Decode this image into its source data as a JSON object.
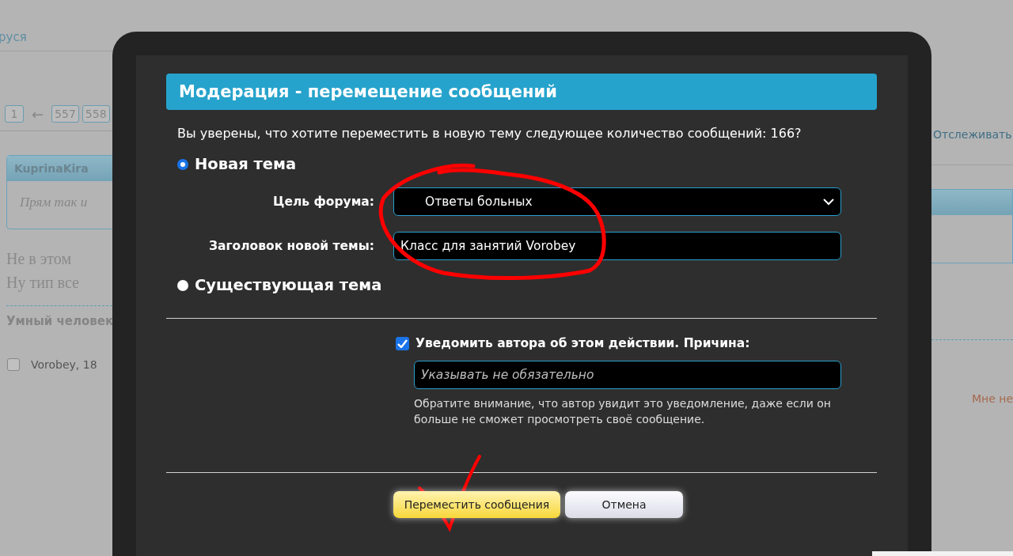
{
  "background_page": {
    "breadcrumb_link": "руся",
    "pagination": [
      "1",
      "←",
      "557",
      "558"
    ],
    "quote": {
      "author": "KuprinaKira",
      "text": "Прям так и"
    },
    "post_lines": [
      "Не в этом",
      "Ну тип все"
    ],
    "signature": "Умный человек",
    "post_meta": {
      "checked": false,
      "author_date": "Vorobey, 18"
    },
    "watch_link": "Отслеживать",
    "dislike_link": "Мне не"
  },
  "dialog": {
    "title": "Модерация - перемещение сообщений",
    "question": "Вы уверены, что хотите переместить в новую тему следующее количество сообщений: 166?",
    "options": [
      {
        "label": "Новая тема",
        "selected": true
      },
      {
        "label": "Существующая тема",
        "selected": false
      }
    ],
    "target_forum": {
      "label": "Цель форума:",
      "value": "Ответы больных"
    },
    "new_title": {
      "label": "Заголовок новой темы:",
      "value": "Класс для занятий Vorobey"
    },
    "notify": {
      "label": "Уведомить автора об этом действии. Причина:",
      "checked": true
    },
    "reason": {
      "placeholder": "Указывать не обязательно"
    },
    "note": "Обратите внимание, что автор увидит это уведомление, даже если он больше не сможет просмотреть своё сообщение.",
    "buttons": [
      {
        "label": "Переместить сообщения",
        "kind": "primary"
      },
      {
        "label": "Отмена",
        "kind": "secondary"
      }
    ]
  }
}
